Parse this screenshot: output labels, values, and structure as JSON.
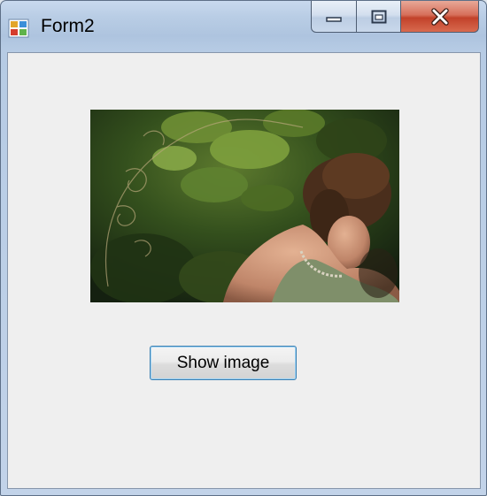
{
  "window": {
    "title": "Form2",
    "icons": {
      "app": "form-app-icon",
      "minimize": "minimize-icon",
      "maximize": "maximize-icon",
      "close": "close-icon"
    }
  },
  "main": {
    "picture": {
      "icon": "photo-woman-in-foliage"
    },
    "show_image_button": "Show image"
  },
  "colors": {
    "title_bar": "#b9cde5",
    "client_background": "#efefef",
    "close_button": "#c2422a",
    "button_focus_border": "#3c7fb1"
  }
}
